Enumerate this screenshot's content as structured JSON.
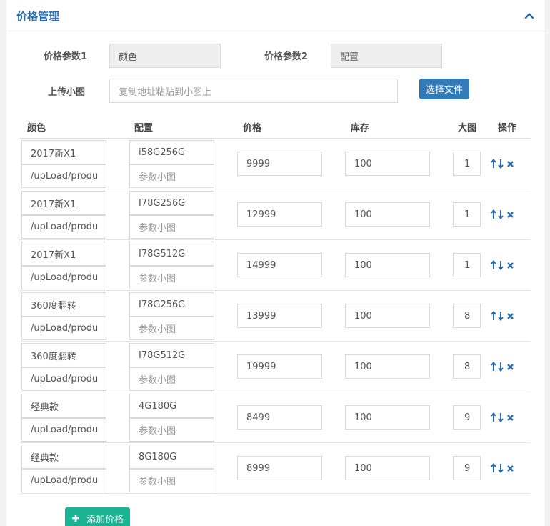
{
  "panel": {
    "title": "价格管理",
    "collapse_icon": "chevron-up-icon"
  },
  "params": {
    "param1_label": "价格参数1",
    "param1_value": "颜色",
    "param2_label": "价格参数2",
    "param2_value": "配置"
  },
  "upload": {
    "label": "上传小图",
    "placeholder": "复制地址粘贴到小图上",
    "button_label": "选择文件"
  },
  "table": {
    "headers": {
      "color": "颜色",
      "config": "配置",
      "price": "价格",
      "stock": "库存",
      "big_image": "大图",
      "actions": "操作"
    },
    "rows": [
      {
        "color": "2017新X1",
        "color_img": "/upLoad/produ",
        "config": "i58G256G",
        "config_img_placeholder": "参数小图",
        "price": "9999",
        "stock": "100",
        "big_image": "1"
      },
      {
        "color": "2017新X1",
        "color_img": "/upLoad/produ",
        "config": "I78G256G",
        "config_img_placeholder": "参数小图",
        "price": "12999",
        "stock": "100",
        "big_image": "1"
      },
      {
        "color": "2017新X1",
        "color_img": "/upLoad/produ",
        "config": "I78G512G",
        "config_img_placeholder": "参数小图",
        "price": "14999",
        "stock": "100",
        "big_image": "1"
      },
      {
        "color": "360度翻转",
        "color_img": "/upLoad/produ",
        "config": "I78G256G",
        "config_img_placeholder": "参数小图",
        "price": "13999",
        "stock": "100",
        "big_image": "8"
      },
      {
        "color": "360度翻转",
        "color_img": "/upLoad/produ",
        "config": "I78G512G",
        "config_img_placeholder": "参数小图",
        "price": "19999",
        "stock": "100",
        "big_image": "8"
      },
      {
        "color": "经典款",
        "color_img": "/upLoad/produ",
        "config": "4G180G",
        "config_img_placeholder": "参数小图",
        "price": "8499",
        "stock": "100",
        "big_image": "9"
      },
      {
        "color": "经典款",
        "color_img": "/upLoad/produ",
        "config": "8G180G",
        "config_img_placeholder": "参数小图",
        "price": "8999",
        "stock": "100",
        "big_image": "9"
      }
    ],
    "row_action_icons": [
      "arrow-up-icon",
      "arrow-down-icon",
      "delete-icon"
    ]
  },
  "add_button": {
    "label": "添加价格",
    "icon": "plus-icon"
  },
  "colors": {
    "primary": "#337ab7",
    "title": "#2a6aa8",
    "success": "#1ab394"
  }
}
